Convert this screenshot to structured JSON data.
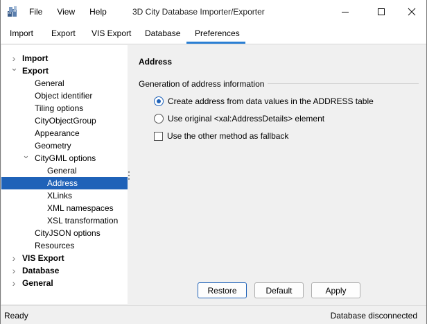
{
  "app": {
    "title": "3D City Database Importer/Exporter",
    "icon": "database-icon"
  },
  "menu": {
    "items": [
      "File",
      "View",
      "Help"
    ]
  },
  "window_controls": {
    "minimize": "minimize-icon",
    "maximize": "maximize-icon",
    "close": "close-icon"
  },
  "tabs": {
    "items": [
      "Import",
      "Export",
      "VIS Export",
      "Database",
      "Preferences"
    ],
    "active": "Preferences",
    "accent_color": "#2a7fd4"
  },
  "tree": {
    "selection_color": "#1f62b8",
    "items": [
      {
        "label": "Import",
        "level": 0,
        "bold": true,
        "expandable": true,
        "expanded": false
      },
      {
        "label": "Export",
        "level": 0,
        "bold": true,
        "expandable": true,
        "expanded": true
      },
      {
        "label": "General",
        "level": 1,
        "bold": false,
        "expandable": false
      },
      {
        "label": "Object identifier",
        "level": 1,
        "bold": false,
        "expandable": false
      },
      {
        "label": "Tiling options",
        "level": 1,
        "bold": false,
        "expandable": false
      },
      {
        "label": "CityObjectGroup",
        "level": 1,
        "bold": false,
        "expandable": false
      },
      {
        "label": "Appearance",
        "level": 1,
        "bold": false,
        "expandable": false
      },
      {
        "label": "Geometry",
        "level": 1,
        "bold": false,
        "expandable": false
      },
      {
        "label": "CityGML options",
        "level": 1,
        "bold": false,
        "expandable": true,
        "expanded": true
      },
      {
        "label": "General",
        "level": 2,
        "bold": false,
        "expandable": false
      },
      {
        "label": "Address",
        "level": 2,
        "bold": false,
        "expandable": false,
        "selected": true
      },
      {
        "label": "XLinks",
        "level": 2,
        "bold": false,
        "expandable": false
      },
      {
        "label": "XML namespaces",
        "level": 2,
        "bold": false,
        "expandable": false
      },
      {
        "label": "XSL transformation",
        "level": 2,
        "bold": false,
        "expandable": false
      },
      {
        "label": "CityJSON options",
        "level": 1,
        "bold": false,
        "expandable": false
      },
      {
        "label": "Resources",
        "level": 1,
        "bold": false,
        "expandable": false
      },
      {
        "label": "VIS Export",
        "level": 0,
        "bold": true,
        "expandable": true,
        "expanded": false
      },
      {
        "label": "Database",
        "level": 0,
        "bold": true,
        "expandable": true,
        "expanded": false
      },
      {
        "label": "General",
        "level": 0,
        "bold": true,
        "expandable": true,
        "expanded": false
      }
    ]
  },
  "panel": {
    "title": "Address",
    "group_title": "Generation of address information",
    "options": [
      {
        "type": "radio",
        "label": "Create address from data values in the ADDRESS table",
        "checked": true
      },
      {
        "type": "radio",
        "label": "Use original <xal:AddressDetails> element",
        "checked": false
      },
      {
        "type": "checkbox",
        "label": "Use the other method as fallback",
        "checked": false
      }
    ]
  },
  "buttons": {
    "restore": "Restore",
    "default": "Default",
    "apply": "Apply"
  },
  "status": {
    "left": "Ready",
    "right": "Database disconnected"
  }
}
